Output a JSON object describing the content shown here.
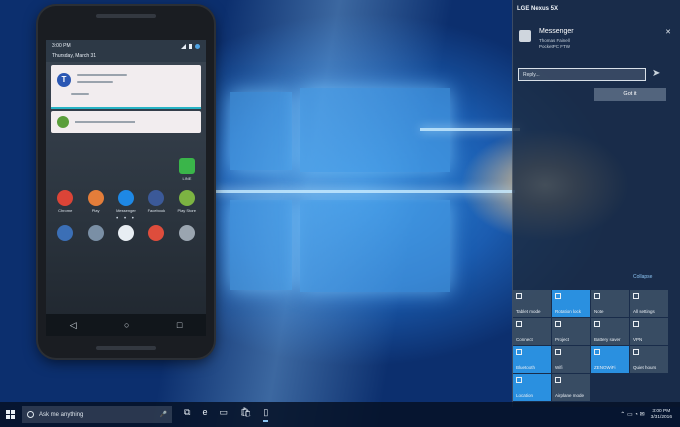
{
  "phone": {
    "status_time": "3:00 PM",
    "status_date": "Thursday, March 31",
    "notification_initial": "T",
    "apps_row1": [
      {
        "label": "Chrome",
        "color": "#db4437"
      },
      {
        "label": "Play",
        "color": "#e37d3a"
      },
      {
        "label": "Messenger",
        "color": "#1e88e5"
      },
      {
        "label": "Facebook",
        "color": "#3b5998"
      },
      {
        "label": "Play Store",
        "color": "#7cb342"
      }
    ],
    "side_app": {
      "label": "LINE",
      "color": "#3ab54a"
    },
    "dots": "• • •",
    "dock_colors": [
      "#3b6fb6",
      "#7a8fa5",
      "#e8eef3",
      "#de4d3c",
      "#9aa5b0"
    ],
    "nav": {
      "back": "◁",
      "home": "○",
      "recents": "□"
    }
  },
  "action_center": {
    "device": "LGE Nexus 5X",
    "message": {
      "app": "Messenger",
      "sender": "Thomas Fainell",
      "source": "PocketPC FTW",
      "close": "✕"
    },
    "reply_placeholder": "Reply...",
    "send_icon": "➤",
    "got_it": "Got it",
    "collapse": "Collapse",
    "tiles": [
      {
        "label": "Tablet mode",
        "on": false
      },
      {
        "label": "Rotation lock",
        "on": true
      },
      {
        "label": "Note",
        "on": false
      },
      {
        "label": "All settings",
        "on": false
      },
      {
        "label": "Connect",
        "on": false
      },
      {
        "label": "Project",
        "on": false
      },
      {
        "label": "Battery saver",
        "on": false
      },
      {
        "label": "VPN",
        "on": false
      },
      {
        "label": "Bluetooth",
        "on": true
      },
      {
        "label": "Wifi",
        "on": false
      },
      {
        "label": "ZENOWiFi",
        "on": true
      },
      {
        "label": "Quiet hours",
        "on": false
      },
      {
        "label": "Location",
        "on": true
      },
      {
        "label": "Airplane mode",
        "on": false
      }
    ]
  },
  "taskbar": {
    "search_placeholder": "Ask me anything",
    "mic": "🎤",
    "icons": [
      "⧉",
      "e",
      "▭",
      "🛍",
      "▯"
    ],
    "tray_icons": "⌃ ▭ ◔ ✉",
    "time": "3:00 PM",
    "date": "3/31/2016"
  }
}
